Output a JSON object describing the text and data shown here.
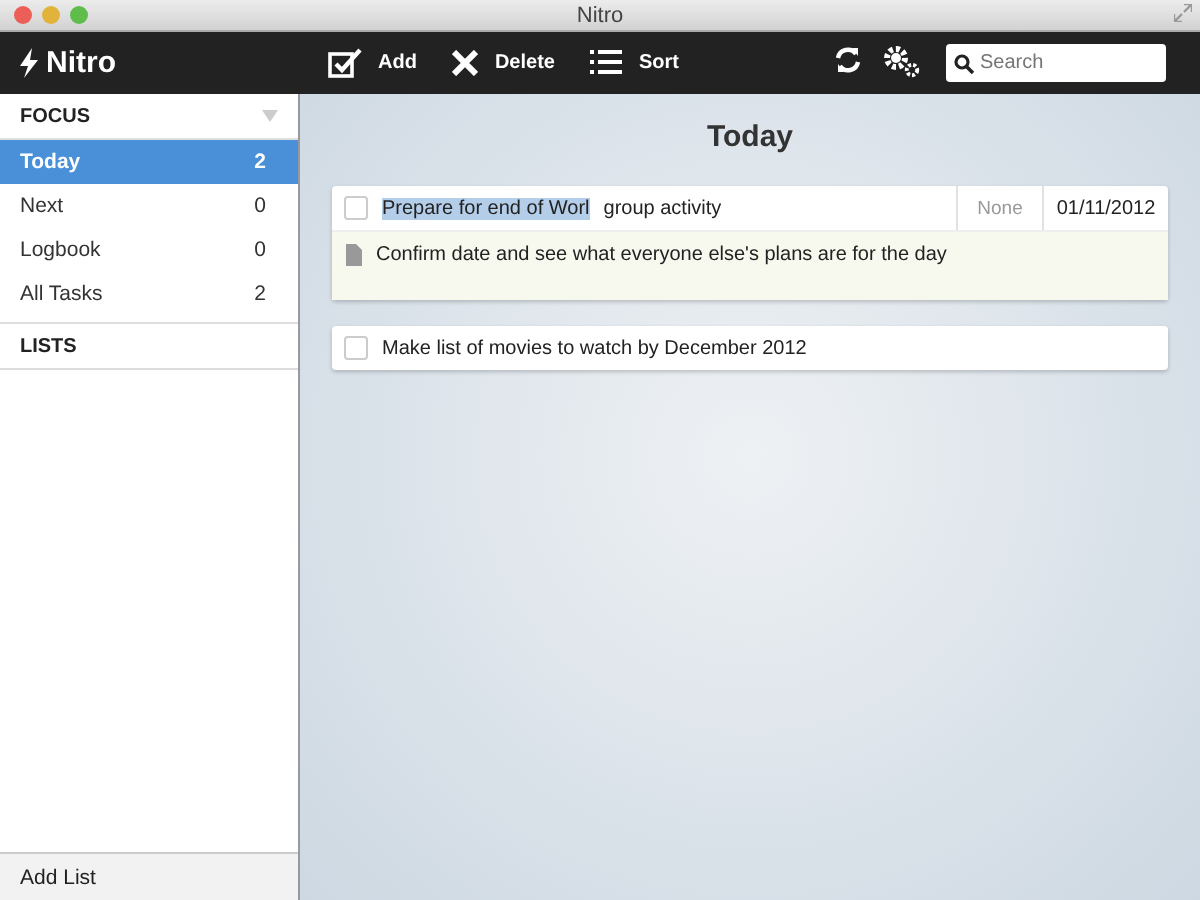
{
  "window": {
    "title": "Nitro"
  },
  "toolbar": {
    "app_name": "Nitro",
    "buttons": [
      {
        "kind": "add",
        "label": "Add"
      },
      {
        "kind": "delete",
        "label": "Delete"
      },
      {
        "kind": "sort",
        "label": "Sort"
      }
    ],
    "search": {
      "placeholder": "Search"
    }
  },
  "sidebar": {
    "focus_header": "FOCUS",
    "items": [
      {
        "label": "Today",
        "count": "2",
        "selected": true
      },
      {
        "label": "Next",
        "count": "0",
        "selected": false
      },
      {
        "label": "Logbook",
        "count": "0",
        "selected": false
      },
      {
        "label": "All Tasks",
        "count": "2",
        "selected": false
      }
    ],
    "lists_header": "LISTS",
    "add_list": "Add List"
  },
  "content": {
    "title": "Today",
    "tasks": [
      {
        "checked": false,
        "title_selected": "Prepare for end of Worl",
        "title": "group activity",
        "priority": "None",
        "date": "01/11/2012",
        "notes": "Confirm date and see what everyone else's plans are for the day"
      },
      {
        "checked": false,
        "title": "Make list of movies to watch by December 2012"
      }
    ]
  }
}
